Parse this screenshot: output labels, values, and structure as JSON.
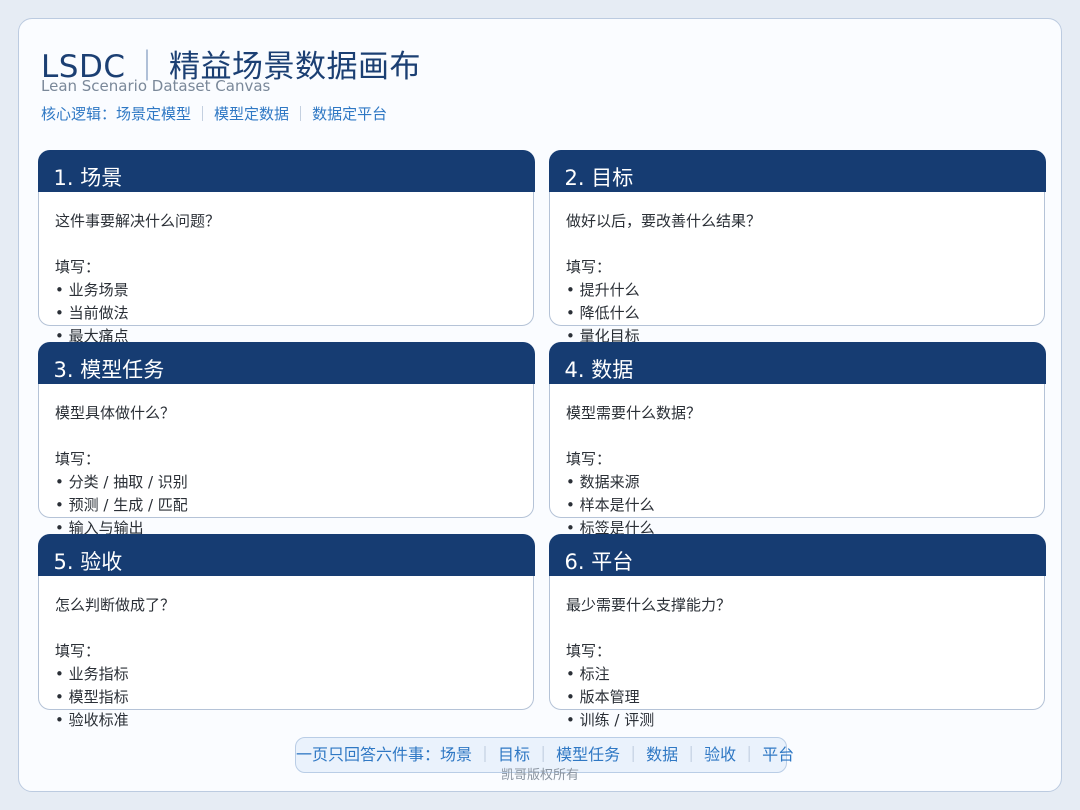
{
  "header": {
    "title_abbr": "LSDC",
    "title_separator": "｜",
    "title_cn": "精益场景数据画布",
    "subtitle": "Lean Scenario Dataset Canvas",
    "logic_prefix": "核心逻辑：",
    "logic_parts": [
      "场景定模型",
      "模型定数据",
      "数据定平台"
    ],
    "logic_separator": "｜"
  },
  "cards": [
    {
      "title": "1. 场景",
      "question": "这件事要解决什么问题？",
      "fill_label": "填写：",
      "items": [
        "• 业务场景",
        "• 当前做法",
        "• 最大痛点"
      ]
    },
    {
      "title": "2. 目标",
      "question": "做好以后，要改善什么结果？",
      "fill_label": "填写：",
      "items": [
        "• 提升什么",
        "• 降低什么",
        "• 量化目标"
      ]
    },
    {
      "title": "3. 模型任务",
      "question": "模型具体做什么？",
      "fill_label": "填写：",
      "items": [
        "• 分类 / 抽取 / 识别",
        "• 预测 / 生成 / 匹配",
        "• 输入与输出"
      ]
    },
    {
      "title": "4. 数据",
      "question": "模型需要什么数据？",
      "fill_label": "填写：",
      "items": [
        "• 数据来源",
        "• 样本是什么",
        "• 标签是什么"
      ]
    },
    {
      "title": "5. 验收",
      "question": "怎么判断做成了？",
      "fill_label": "填写：",
      "items": [
        "• 业务指标",
        "• 模型指标",
        "• 验收标准"
      ]
    },
    {
      "title": "6. 平台",
      "question": "最少需要什么支撑能力？",
      "fill_label": "填写：",
      "items": [
        "• 标注",
        "• 版本管理",
        "• 训练 / 评测"
      ]
    }
  ],
  "footer": {
    "summary_prefix": "一页只回答六件事：",
    "summary_items": [
      "场景",
      "目标",
      "模型任务",
      "数据",
      "验收",
      "平台"
    ],
    "summary_separator": "｜",
    "copyright": "凯哥版权所有"
  },
  "colors": {
    "header_band": "#163c72",
    "title_text": "#1b3f73",
    "accent_blue": "#2f78c4",
    "card_border": "#b5c3d7",
    "page_background": "#fafcff"
  }
}
